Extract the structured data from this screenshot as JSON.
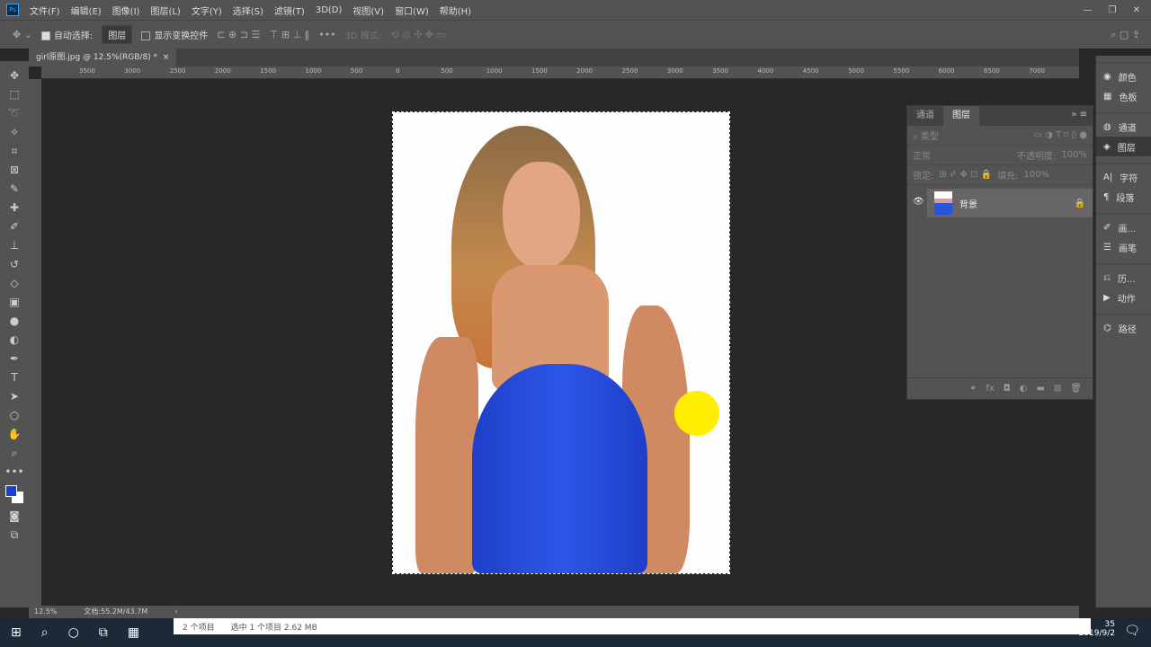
{
  "menu": [
    "文件(F)",
    "编辑(E)",
    "图像(I)",
    "图层(L)",
    "文字(Y)",
    "选择(S)",
    "滤镜(T)",
    "3D(D)",
    "视图(V)",
    "窗口(W)",
    "帮助(H)"
  ],
  "options": {
    "auto_select": "自动选择:",
    "auto_select_target": "图层",
    "show_transform": "显示变换控件",
    "mode_3d": "3D 模式:"
  },
  "document_tab": "girl原图.jpg @ 12.5%(RGB/8) *",
  "ruler_labels": [
    "3500",
    "3000",
    "2500",
    "2000",
    "1500",
    "1000",
    "500",
    "0",
    "500",
    "1000",
    "1500",
    "2000",
    "2500",
    "3000",
    "3500",
    "4000",
    "4500",
    "5000",
    "5500",
    "6000",
    "6500",
    "7000"
  ],
  "status": {
    "zoom": "12.5%",
    "doc": "文档:55.2M/43.7M"
  },
  "layers_panel": {
    "tabs": [
      "通道",
      "图层"
    ],
    "filter": "类型",
    "blend": "正常",
    "opacity_label": "不透明度:",
    "opacity": "100%",
    "lock_label": "锁定:",
    "fill_label": "填充:",
    "fill": "100%",
    "layer_name": "背景"
  },
  "dock": [
    "颜色",
    "色板",
    "通道",
    "图层",
    "字符",
    "段落",
    "画...",
    "画笔",
    "历...",
    "动作",
    "路径"
  ],
  "explorer": {
    "items": "2 个项目",
    "selected": "选中 1 个项目  2.62 MB"
  },
  "clock": {
    "time": "35",
    "date": "2019/9/2"
  },
  "colors": {
    "foreground": "#1a3fd8",
    "background": "#ffffff",
    "cursor_highlight": "#ffee00"
  }
}
